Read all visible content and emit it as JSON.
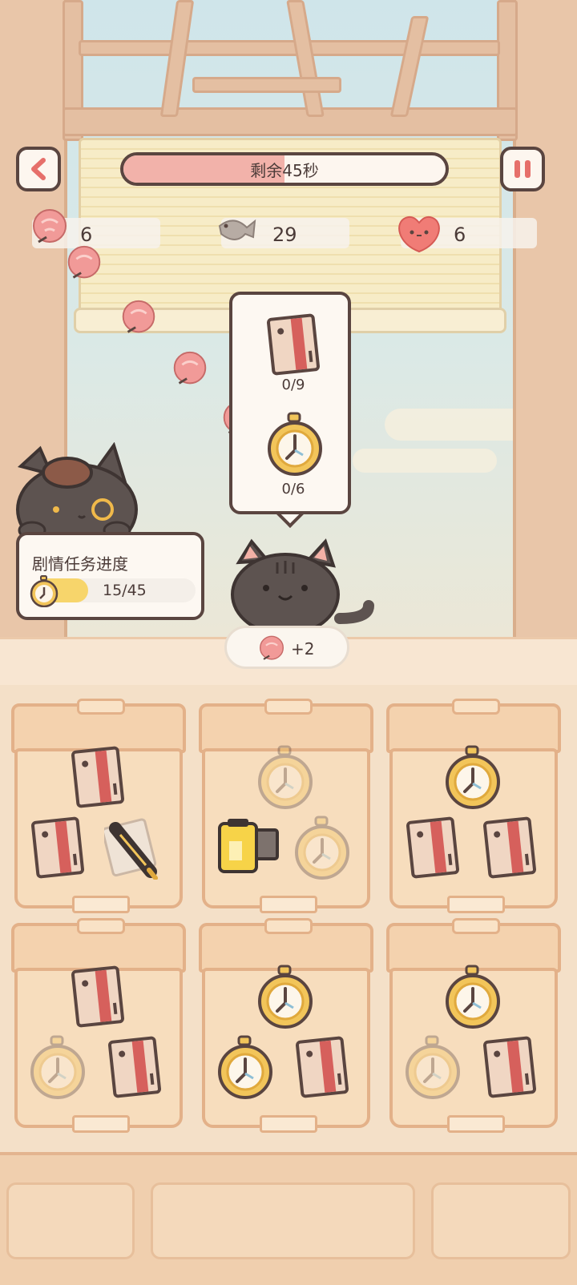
{
  "hud": {
    "timer_text": "剩余45秒",
    "timer_fraction": 0.5,
    "flowers_count": "6",
    "fish_count": "29",
    "hearts_count": "6"
  },
  "order": {
    "items": [
      {
        "icon": "card-pack-icon",
        "progress": "0/9"
      },
      {
        "icon": "pocket-watch-icon",
        "progress": "0/6"
      }
    ]
  },
  "story": {
    "title": "剧情任务进度",
    "progress_text": "15/45",
    "progress_fraction": 0.33
  },
  "reward": {
    "text": "+2"
  },
  "colors": {
    "accent_red": "#e66f6a",
    "outline": "#5a4540",
    "progress_yellow": "#f7d56b"
  },
  "boxes": [
    {
      "items": [
        "card-pack",
        "pen",
        "card-pack"
      ]
    },
    {
      "items": [
        "pocket-watch-faded",
        "pocket-watch-faded",
        "film-roll"
      ]
    },
    {
      "items": [
        "pocket-watch",
        "card-pack",
        "card-pack"
      ]
    },
    {
      "items": [
        "card-pack",
        "card-pack",
        "pocket-watch-faded"
      ]
    },
    {
      "items": [
        "pocket-watch",
        "card-pack",
        "pocket-watch"
      ]
    },
    {
      "items": [
        "pocket-watch",
        "card-pack",
        "pocket-watch-faded"
      ]
    }
  ]
}
